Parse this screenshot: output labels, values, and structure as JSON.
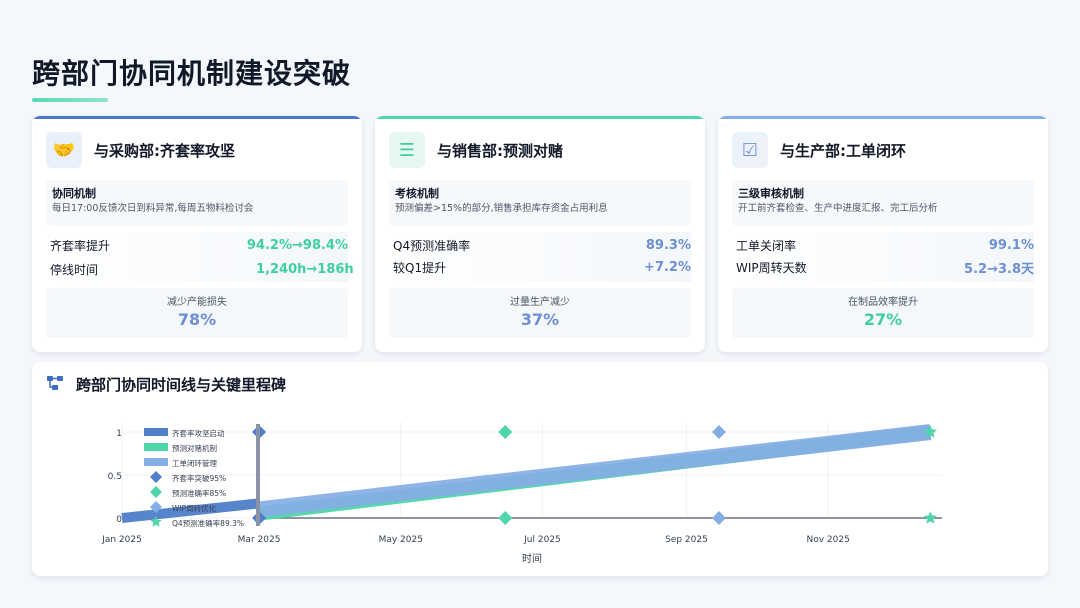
{
  "page": {
    "title": "跨部门协同机制建设突破"
  },
  "colors": {
    "green": "#4fd6a8",
    "blue": "#6f95d6",
    "lightblue": "#86aee6",
    "text_green": "#3fcf9f",
    "text_blue": "#6d8fd3"
  },
  "cards": [
    {
      "icon": "handshake-icon",
      "icon_glyph": "🤝",
      "title": "与采购部:齐套率攻坚",
      "mech_title": "协同机制",
      "mech_desc": "每日17:00反馈次日到料异常,每周五物料检讨会",
      "metrics": [
        {
          "label": "齐套率提升",
          "value": "94.2%→98.4%"
        },
        {
          "label": "停线时间",
          "value": "1,240h→186h"
        }
      ],
      "summary_label": "减少产能损失",
      "summary_value": "78%"
    },
    {
      "icon": "bar-list-icon",
      "icon_glyph": "☰",
      "title": "与销售部:预测对赌",
      "mech_title": "考核机制",
      "mech_desc": "预测偏差>15%的部分,销售承担库存资金占用利息",
      "metrics": [
        {
          "label": "Q4预测准确率",
          "value": "89.3%"
        },
        {
          "label": "较Q1提升",
          "value": "+7.2%"
        }
      ],
      "summary_label": "过量生产减少",
      "summary_value": "37%"
    },
    {
      "icon": "checklist-icon",
      "icon_glyph": "☑",
      "title": "与生产部:工单闭环",
      "mech_title": "三级审核机制",
      "mech_desc": "开工前齐套检查、生产中进度汇报、完工后分析",
      "metrics": [
        {
          "label": "工单关闭率",
          "value": "99.1%"
        },
        {
          "label": "WIP周转天数",
          "value": "5.2→3.8天"
        }
      ],
      "summary_label": "在制品效率提升",
      "summary_value": "27%"
    }
  ],
  "timeline": {
    "title": "跨部门协同时间线与关键里程碑",
    "icon": "flow-chart-icon"
  },
  "chart_data": {
    "type": "line",
    "xlabel": "时间",
    "ylabel": "",
    "x_ticks": [
      "Jan 2025",
      "Mar 2025",
      "May 2025",
      "Jul 2025",
      "Sep 2025",
      "Nov 2025"
    ],
    "x_range": [
      "2025-01",
      "2025-12-20"
    ],
    "ylim": [
      0,
      1
    ],
    "y_ticks": [
      "0",
      "0.5",
      "1"
    ],
    "grid": true,
    "legend": "top-left",
    "series": [
      {
        "name": "齐套率攻坚启动",
        "kind": "bar-line",
        "color": "#4f7fc9",
        "points": [
          [
            "2025-01-01",
            0
          ],
          [
            "2025-03-01",
            0.17
          ]
        ]
      },
      {
        "name": "预测对赌机制",
        "kind": "bar-line",
        "color": "#4fd6a8",
        "points": [
          [
            "2025-03-01",
            0.05
          ],
          [
            "2025-12-15",
            1
          ]
        ]
      },
      {
        "name": "工单闭环管理",
        "kind": "bar-line",
        "color": "#86aee6",
        "points": [
          [
            "2025-03-01",
            0.1
          ],
          [
            "2025-12-15",
            1
          ]
        ]
      }
    ],
    "milestones": [
      {
        "name": "齐套率突破95%",
        "marker": "diamond",
        "color": "#4f7fc9",
        "date": "2025-03-01"
      },
      {
        "name": "预测准确率85%",
        "marker": "diamond",
        "color": "#4fd6a8",
        "date": "2025-06-15"
      },
      {
        "name": "WIP周转优化",
        "marker": "diamond",
        "color": "#86aee6",
        "date": "2025-09-15"
      },
      {
        "name": "Q4预测准确率89.3%",
        "marker": "star",
        "color": "#4fd6a8",
        "date": "2025-12-15"
      }
    ]
  }
}
